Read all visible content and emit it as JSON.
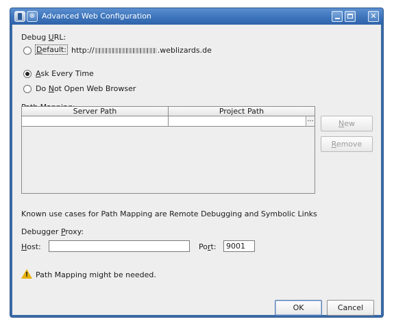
{
  "window": {
    "title": "Advanced Web Configuration"
  },
  "debug_url": {
    "label_prefix": "Debug ",
    "label_mnemonic": "U",
    "label_suffix": "RL:",
    "options": [
      {
        "mnemonic": "D",
        "rest": "efault:",
        "selected": false
      },
      {
        "mnemonic": "A",
        "rest": "sk Every Time",
        "selected": true
      },
      {
        "prefix": "Do ",
        "mnemonic": "N",
        "rest": "ot Open Web Browser",
        "selected": false
      }
    ],
    "default_url_start": "http://",
    "default_url_end": ".weblizards.de"
  },
  "path_mapping": {
    "label_prefix": "Path ",
    "label_mnemonic": "M",
    "label_suffix": "apping:",
    "columns": [
      "Server Path",
      "Project Path"
    ],
    "ellipsis": "...",
    "new_mnemonic": "N",
    "new_rest": "ew",
    "remove_mnemonic": "R",
    "remove_rest": "emove"
  },
  "info_text": "Known use cases for Path Mapping are Remote Debugging and Symbolic Links",
  "proxy": {
    "label_prefix": "Debugger ",
    "label_mnemonic": "P",
    "label_suffix": "roxy:",
    "host_mnemonic": "H",
    "host_rest": "ost:",
    "host_value": "",
    "port_prefix": "Po",
    "port_mnemonic": "r",
    "port_suffix": "t:",
    "port_value": "9001"
  },
  "warning": {
    "icon": "warning-triangle-icon",
    "text": "Path Mapping might be needed."
  },
  "buttons": {
    "ok": "OK",
    "cancel": "Cancel"
  }
}
